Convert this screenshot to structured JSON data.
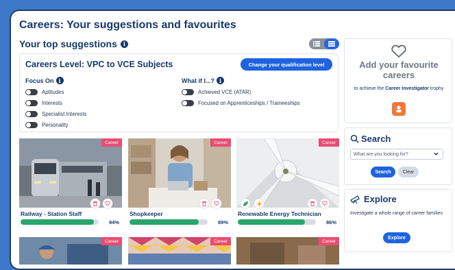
{
  "page": {
    "title": "Careers: Your suggestions and favourites",
    "subtitle": "Your top suggestions"
  },
  "level": {
    "title": "Careers Level: VPC to VCE Subjects",
    "change_button": "Change your qualification level"
  },
  "focus": {
    "heading": "Focus On",
    "items": [
      "Aptitudes",
      "Interests",
      "Specialist Interests",
      "Personality"
    ]
  },
  "whatif": {
    "heading": "What if I...?",
    "items": [
      "Achieved VCE (ATAR)",
      "Focused on Apprenticeships / Traineeships"
    ]
  },
  "cards": [
    {
      "tag": "Career",
      "name": "Railway - Station Staff",
      "pct_label": "94%",
      "match": 94
    },
    {
      "tag": "Career",
      "name": "Shopkeeper",
      "pct_label": "89%",
      "match": 89
    },
    {
      "tag": "Career",
      "name": "Renewable Energy Technician",
      "pct_label": "86%",
      "match": 86
    }
  ],
  "row2_tags": [
    "Career",
    "Career",
    "Career"
  ],
  "favourites": {
    "title": "Add your favourite careers",
    "sub_before": "to achieve the",
    "sub_bold": "Career Investigator",
    "sub_after": "trophy"
  },
  "search": {
    "title": "Search",
    "placeholder": "What are you looking for?",
    "search_button": "Search",
    "clear_button": "Clear"
  },
  "explore": {
    "title": "Explore",
    "text": "Investigate a whole range of career families",
    "button": "Explore"
  },
  "colors": {
    "background": "#3d79c8",
    "brand": "#173a6b",
    "primary_button": "#1f63e0",
    "career_tag": "#e94d71",
    "match_bar": "#2aa56c",
    "trophy": "#f07a3a"
  }
}
